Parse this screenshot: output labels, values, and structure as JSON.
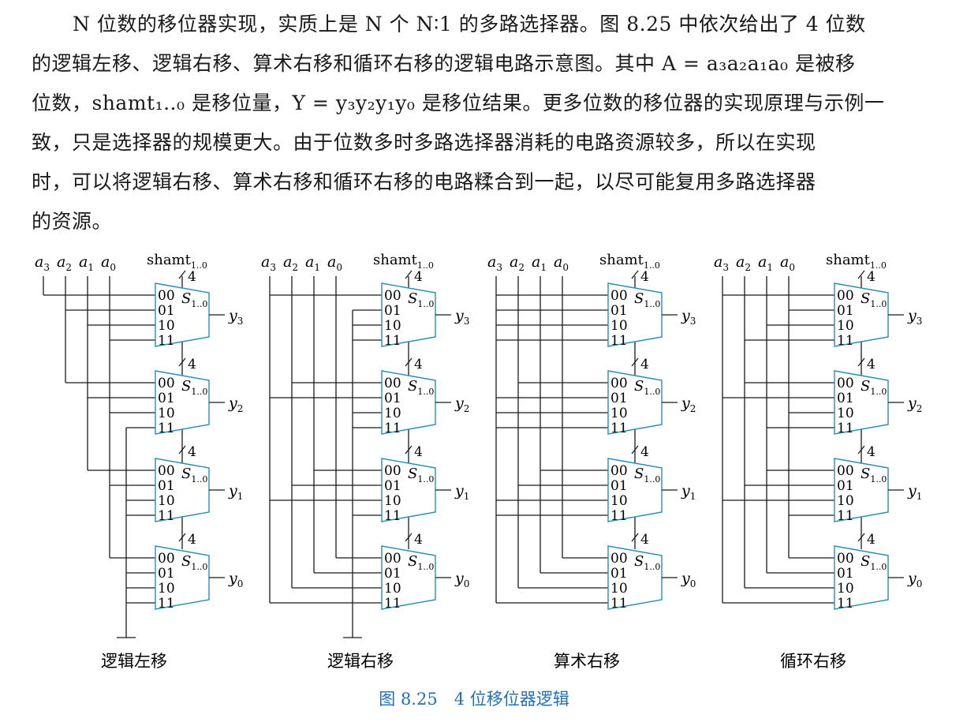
{
  "paragraph": {
    "lines": [
      "N 位数的移位器实现，实质上是 N 个 N∶1 的多路选择器。图 8.25 中依次给出了 4 位数",
      "的逻辑左移、逻辑右移、算术右移和循环右移的逻辑电路示意图。其中 A = a₃a₂a₁a₀ 是被移",
      "位数，shamt₁..₀ 是移位量，Y = y₃y₂y₁y₀ 是移位结果。更多位数的移位器的实现原理与示例一",
      "致，只是选择器的规模更大。由于位数多时多路选择器消耗的电路资源较多，所以在实现",
      "时，可以将逻辑右移、算术右移和循环右移的电路糅合到一起，以尽可能复用多路选择器",
      "的资源。"
    ]
  },
  "figure": {
    "input_labels": [
      "a",
      "a",
      "a",
      "a"
    ],
    "input_subscripts": [
      "3",
      "2",
      "1",
      "0"
    ],
    "shamt_label": "shamt",
    "shamt_subscript": "1..0",
    "bus_width": "4",
    "select_label": "S",
    "select_subscript": "1..0",
    "mux_inputs": [
      "00",
      "01",
      "10",
      "11"
    ],
    "output_label": "y",
    "output_subscripts": [
      "3",
      "2",
      "1",
      "0"
    ],
    "circuits": [
      {
        "caption": "逻辑左移"
      },
      {
        "caption": "逻辑右移"
      },
      {
        "caption": "算术右移"
      },
      {
        "caption": "循环右移"
      }
    ],
    "figure_caption": "图 8.25　4 位移位器逻辑",
    "colors": {
      "mux": "#2a8fb8",
      "caption": "#1f6fb5",
      "line": "#1a1a1a"
    }
  }
}
